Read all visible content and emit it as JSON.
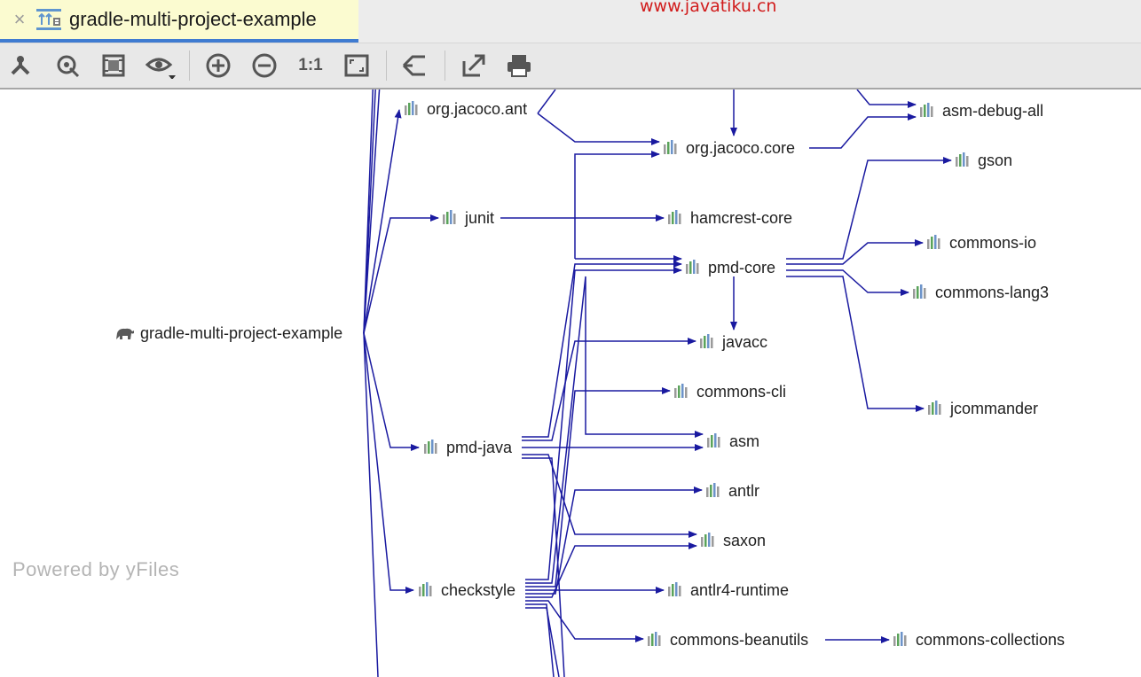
{
  "tab": {
    "title": "gradle-multi-project-example",
    "close_symbol": "×",
    "icon": "gradle-dependencies-icon"
  },
  "watermark": "www.javatiku.cn",
  "toolbar": {
    "buttons": [
      {
        "name": "layout-tree-icon"
      },
      {
        "name": "fit-content-icon"
      },
      {
        "name": "select-frame-icon"
      },
      {
        "name": "view-options-icon"
      },
      {
        "name": "zoom-in-icon"
      },
      {
        "name": "zoom-out-icon"
      },
      {
        "name": "actual-size-icon",
        "label": "1:1"
      },
      {
        "name": "fit-page-icon"
      },
      {
        "name": "hierarchy-icon"
      },
      {
        "name": "export-icon"
      },
      {
        "name": "print-icon"
      }
    ]
  },
  "graph": {
    "root": "gradle-multi-project-example",
    "nodes": [
      "org.jacoco.ant",
      "org.jacoco.core",
      "asm-debug-all",
      "junit",
      "hamcrest-core",
      "gson",
      "pmd-core",
      "commons-io",
      "commons-lang3",
      "javacc",
      "commons-cli",
      "jcommander",
      "pmd-java",
      "asm",
      "antlr",
      "saxon",
      "checkstyle",
      "antlr4-runtime",
      "commons-beanutils",
      "commons-collections"
    ],
    "edge_color": "#1a1aa0"
  },
  "footer": {
    "powered_by": "Powered by yFiles"
  }
}
